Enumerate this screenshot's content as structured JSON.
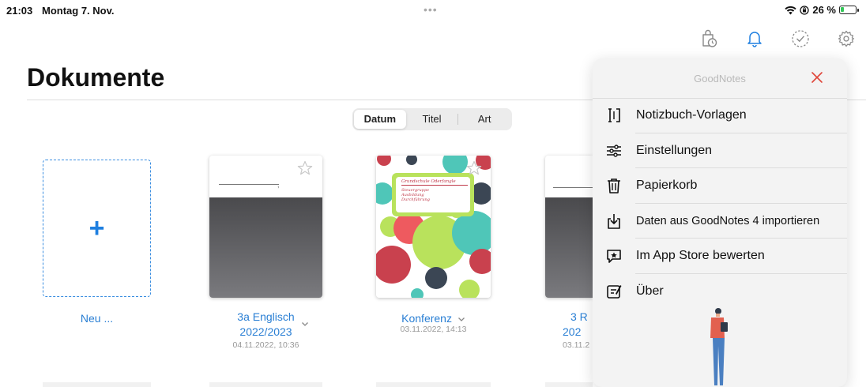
{
  "status_bar": {
    "time": "21:03",
    "date": "Montag 7. Nov.",
    "battery_text": "26 %",
    "battery_level": 0.26,
    "multitask_indicator": "•••"
  },
  "toolbar": {
    "icons": [
      "shopping-bag-clock-icon",
      "bell-icon",
      "check-circle-icon",
      "gear-icon"
    ],
    "accent": "#1e7fe0"
  },
  "page": {
    "title": "Dokumente"
  },
  "sort": {
    "options": [
      "Datum",
      "Titel",
      "Art"
    ],
    "selected": "Datum"
  },
  "documents": [
    {
      "title": "Neu ...",
      "date": "",
      "type": "new"
    },
    {
      "title_line1": "3a Englisch",
      "title_line2": "2022/2023",
      "date": "04.11.2022, 10:36",
      "favorite": false
    },
    {
      "title": "Konferenz",
      "date": "03.11.2022, 14:13",
      "favorite": false,
      "cover_note": [
        "Grundschule Oderfangle",
        "Steuergruppe",
        "Ausbildung",
        "Durchführung"
      ]
    },
    {
      "title_line1": "3 R",
      "title_line2": "202",
      "date": "03.11.2"
    }
  ],
  "menu_panel": {
    "title": "GoodNotes",
    "close_color": "#e0463a",
    "items": [
      {
        "label": "Notizbuch-Vorlagen",
        "icon": "notebook-template-icon"
      },
      {
        "label": "Einstellungen",
        "icon": "sliders-icon"
      },
      {
        "label": "Papierkorb",
        "icon": "trash-icon"
      },
      {
        "label": "Daten aus GoodNotes 4 importieren",
        "icon": "import-icon"
      },
      {
        "label": "Im App Store bewerten",
        "icon": "rate-star-icon"
      },
      {
        "label": "Über",
        "icon": "about-icon"
      }
    ]
  }
}
